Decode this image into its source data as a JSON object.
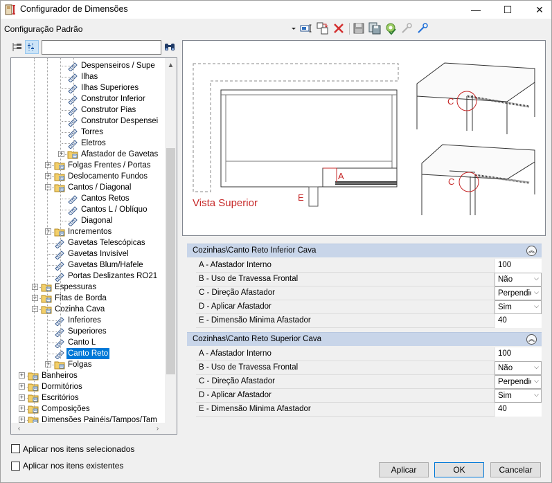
{
  "window": {
    "title": "Configurador de Dimensões",
    "minimize": "—",
    "maximize": "☐",
    "close": "✕"
  },
  "config_label": "Configuração Padrão",
  "toolbar_icons": [
    "dropdown-arrow-icon",
    "text-field-icon",
    "copy-icon",
    "delete-icon",
    "save-icon",
    "save-as-icon",
    "settings-check-icon",
    "link-disabled-icon",
    "link-icon"
  ],
  "tree": {
    "search_value": "",
    "items": [
      {
        "label": "Despenseiros / Supe",
        "level": 4,
        "type": "leaf"
      },
      {
        "label": "Ilhas",
        "level": 4,
        "type": "leaf"
      },
      {
        "label": "Ilhas Superiores",
        "level": 4,
        "type": "leaf"
      },
      {
        "label": "Construtor Inferior",
        "level": 4,
        "type": "leaf"
      },
      {
        "label": "Construtor Pias",
        "level": 4,
        "type": "leaf"
      },
      {
        "label": "Construtor Despensei",
        "level": 4,
        "type": "leaf"
      },
      {
        "label": "Torres",
        "level": 4,
        "type": "leaf"
      },
      {
        "label": "Eletros",
        "level": 4,
        "type": "leaf"
      },
      {
        "label": "Afastador de Gavetas",
        "level": 4,
        "type": "folder",
        "state": "collapsed"
      },
      {
        "label": "Folgas Frentes / Portas",
        "level": 3,
        "type": "folder",
        "state": "collapsed"
      },
      {
        "label": "Deslocamento Fundos",
        "level": 3,
        "type": "folder",
        "state": "collapsed"
      },
      {
        "label": "Cantos / Diagonal",
        "level": 3,
        "type": "folder",
        "state": "expanded"
      },
      {
        "label": "Cantos Retos",
        "level": 4,
        "type": "leaf"
      },
      {
        "label": "Cantos L / Oblíquo",
        "level": 4,
        "type": "leaf"
      },
      {
        "label": "Diagonal",
        "level": 4,
        "type": "leaf"
      },
      {
        "label": "Incrementos",
        "level": 3,
        "type": "folder",
        "state": "collapsed"
      },
      {
        "label": "Gavetas Telescópicas",
        "level": 3,
        "type": "leaf"
      },
      {
        "label": "Gavetas Invisível",
        "level": 3,
        "type": "leaf"
      },
      {
        "label": "Gavetas Blum/Hafele",
        "level": 3,
        "type": "leaf"
      },
      {
        "label": "Portas Deslizantes RO21",
        "level": 3,
        "type": "leaf"
      },
      {
        "label": "Espessuras",
        "level": 2,
        "type": "folder",
        "state": "collapsed"
      },
      {
        "label": "Fitas de Borda",
        "level": 2,
        "type": "folder",
        "state": "collapsed"
      },
      {
        "label": "Cozinha Cava",
        "level": 2,
        "type": "folder",
        "state": "expanded"
      },
      {
        "label": "Inferiores",
        "level": 3,
        "type": "leaf"
      },
      {
        "label": "Superiores",
        "level": 3,
        "type": "leaf"
      },
      {
        "label": "Canto L",
        "level": 3,
        "type": "leaf"
      },
      {
        "label": "Canto Reto",
        "level": 3,
        "type": "leaf",
        "selected": true
      },
      {
        "label": "Folgas",
        "level": 3,
        "type": "folder",
        "state": "collapsed"
      },
      {
        "label": "Banheiros",
        "level": 1,
        "type": "folder",
        "state": "collapsed"
      },
      {
        "label": "Dormitórios",
        "level": 1,
        "type": "folder",
        "state": "collapsed"
      },
      {
        "label": "Escritórios",
        "level": 1,
        "type": "folder",
        "state": "collapsed"
      },
      {
        "label": "Composições",
        "level": 1,
        "type": "folder",
        "state": "collapsed"
      },
      {
        "label": "Dimensões Painéis/Tampos/Tam",
        "level": 1,
        "type": "folder",
        "state": "collapsed"
      }
    ]
  },
  "diagram": {
    "title": "Vista Superior",
    "label_a": "A",
    "label_e": "E",
    "label_c1": "C",
    "label_c2": "C",
    "accent_color": "#c62828"
  },
  "groups": [
    {
      "title": "Cozinhas\\Canto Reto Inferior Cava",
      "rows": [
        {
          "label": "A -  Afastador Interno",
          "value": "100",
          "kind": "text"
        },
        {
          "label": "B -  Uso de Travessa Frontal",
          "value": "Não",
          "kind": "select"
        },
        {
          "label": "C - Direção Afastador",
          "value": "Perpendicular",
          "kind": "select"
        },
        {
          "label": "D - Aplicar Afastador",
          "value": "Sim",
          "kind": "select"
        },
        {
          "label": "E - Dimensão Minima Afastador",
          "value": "40",
          "kind": "text"
        }
      ]
    },
    {
      "title": "Cozinhas\\Canto Reto Superior Cava",
      "rows": [
        {
          "label": "A -  Afastador Interno",
          "value": "100",
          "kind": "text"
        },
        {
          "label": "B -  Uso de Travessa Frontal",
          "value": "Não",
          "kind": "select"
        },
        {
          "label": "C - Direção Afastador",
          "value": "Perpendicular",
          "kind": "select"
        },
        {
          "label": "D - Aplicar Afastador",
          "value": "Sim",
          "kind": "select"
        },
        {
          "label": "E - Dimensão Minima Afastador",
          "value": "40",
          "kind": "text"
        }
      ]
    }
  ],
  "bottom": {
    "apply_selected": "Aplicar nos itens selecionados",
    "apply_existing": "Aplicar nos itens existentes",
    "btn_apply": "Aplicar",
    "btn_ok": "OK",
    "btn_cancel": "Cancelar"
  }
}
